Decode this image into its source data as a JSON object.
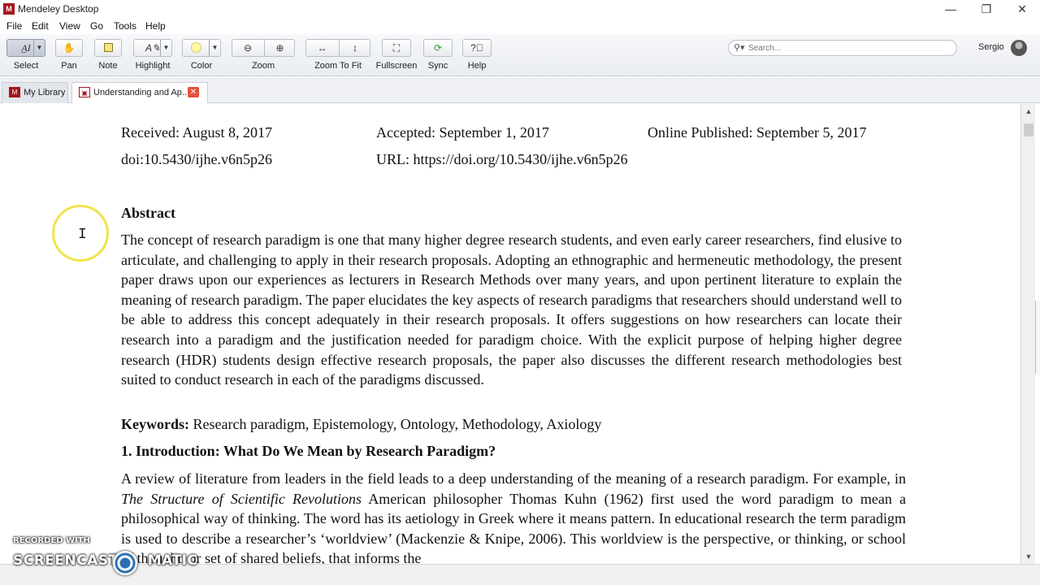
{
  "window": {
    "title": "Mendeley Desktop",
    "controls": [
      "—",
      "❐",
      "✕"
    ]
  },
  "menu": [
    "File",
    "Edit",
    "View",
    "Go",
    "Tools",
    "Help"
  ],
  "toolbar": {
    "select": "Select",
    "pan": "Pan",
    "note": "Note",
    "highlight": "Highlight",
    "color": "Color",
    "zoom": "Zoom",
    "zoom_to_fit": "Zoom To Fit",
    "fullscreen": "Fullscreen",
    "sync": "Sync",
    "help": "Help"
  },
  "search": {
    "placeholder": "Search..."
  },
  "user": {
    "name": "Sergio"
  },
  "tabs": {
    "library": "My Library",
    "document": "Understanding and Ap..."
  },
  "document": {
    "received": "Received: August 8, 2017",
    "accepted": "Accepted: September 1, 2017",
    "published": "Online Published: September 5, 2017",
    "doi": "doi:10.5430/ijhe.v6n5p26",
    "url": "URL: https://doi.org/10.5430/ijhe.v6n5p26",
    "abstract_heading": "Abstract",
    "abstract": "The concept of research paradigm is one that many higher degree research students, and even early career researchers, find elusive to articulate, and challenging to apply in their research proposals. Adopting an ethnographic and hermeneutic methodology, the present paper draws upon our experiences as lecturers in Research Methods over many years, and upon pertinent literature to explain the meaning of research paradigm. The paper elucidates the key aspects of research paradigms that researchers should understand well to be able to address this concept adequately in their research proposals. It offers suggestions on how researchers can locate their research into a paradigm and the justification needed for paradigm choice. With the explicit purpose of helping higher degree research (HDR) students design effective research proposals, the paper also discusses the different research methodologies best suited to conduct research in each of the paradigms discussed.",
    "keywords_label": "Keywords:",
    "keywords": "Research paradigm, Epistemology, Ontology, Methodology, Axiology",
    "intro_heading": "1. Introduction: What Do We Mean by Research Paradigm?",
    "intro_p1": "A review of literature from leaders in the field leads to a deep understanding of the meaning of a research paradigm. For example, in ",
    "intro_italic": "The Structure of Scientific Revolutions",
    "intro_p2": " American philosopher Thomas Kuhn (1962) first used the word paradigm to mean a philosophical way of thinking. The word has its aetiology in Greek where it means pattern. In educational research the term paradigm is used to describe a researcher’s ‘worldview’ (Mackenzie & Knipe, 2006). This worldview is the perspective, or thinking, or school of thought, or set of shared beliefs, that informs the"
  },
  "watermark": {
    "top": "RECORDED WITH",
    "brand_left": "SCREENCAST",
    "brand_right": "MATIC"
  }
}
